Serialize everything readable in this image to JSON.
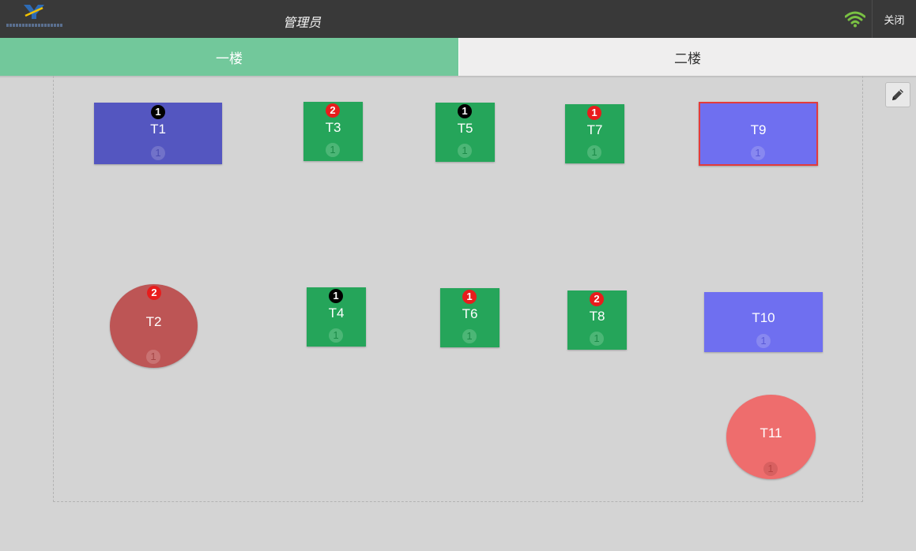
{
  "header": {
    "title": "管理员",
    "close_label": "关闭",
    "logo_icon": "company-logo",
    "wifi_icon": "wifi-icon",
    "wifi_color": "#7ac143"
  },
  "tabs": [
    {
      "label": "一楼",
      "active": true
    },
    {
      "label": "二楼",
      "active": false
    }
  ],
  "edit_icon": "pencil-icon",
  "colors": {
    "active_tab": "#72c89b",
    "dark_blue": "#5456c0",
    "blue": "#6f6ff0",
    "green": "#25a55a",
    "dark_red": "#bd5555",
    "red": "#ee6d6d",
    "selected_border": "#e33b3b"
  },
  "tables": [
    {
      "name": "T1",
      "orders": "1",
      "order_color": "black",
      "guests": "1",
      "status": "dark_blue"
    },
    {
      "name": "T3",
      "orders": "2",
      "order_color": "red",
      "guests": "1",
      "status": "green"
    },
    {
      "name": "T5",
      "orders": "1",
      "order_color": "black",
      "guests": "1",
      "status": "green"
    },
    {
      "name": "T7",
      "orders": "1",
      "order_color": "red",
      "guests": "1",
      "status": "green"
    },
    {
      "name": "T9",
      "orders": "",
      "order_color": "",
      "guests": "1",
      "status": "blue",
      "selected": true
    },
    {
      "name": "T2",
      "orders": "2",
      "order_color": "red",
      "guests": "1",
      "status": "dark_red"
    },
    {
      "name": "T4",
      "orders": "1",
      "order_color": "black",
      "guests": "1",
      "status": "green"
    },
    {
      "name": "T6",
      "orders": "1",
      "order_color": "red",
      "guests": "1",
      "status": "green"
    },
    {
      "name": "T8",
      "orders": "2",
      "order_color": "red",
      "guests": "1",
      "status": "green"
    },
    {
      "name": "T10",
      "orders": "",
      "order_color": "",
      "guests": "1",
      "status": "blue"
    },
    {
      "name": "T11",
      "orders": "",
      "order_color": "",
      "guests": "1",
      "status": "red"
    }
  ]
}
